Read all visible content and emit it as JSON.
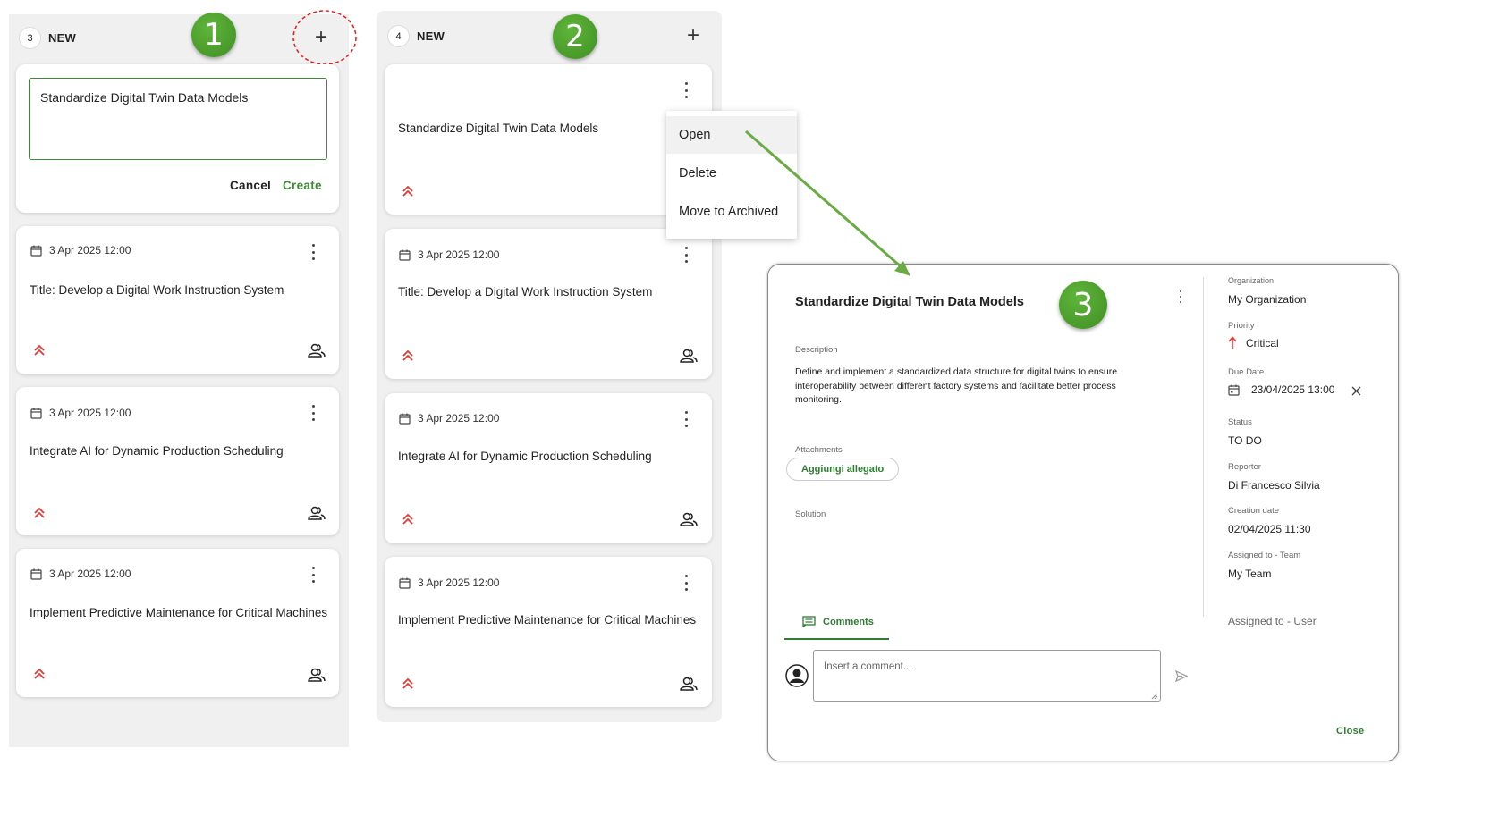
{
  "colors": {
    "accent_green": "#3d8b37",
    "priority_red": "#e53935",
    "column_bg": "#f0f0f0",
    "step_circle": "#4a9e2a"
  },
  "step_labels": [
    "1",
    "2",
    "3"
  ],
  "column1": {
    "count": "3",
    "title": "NEW",
    "new_card": {
      "input_value": "Standardize Digital Twin Data Models",
      "cancel_label": "Cancel",
      "create_label": "Create"
    },
    "cards": [
      {
        "date": "3 Apr 2025 12:00",
        "title": "Title: Develop a Digital Work Instruction System"
      },
      {
        "date": "3 Apr 2025 12:00",
        "title": "Integrate AI for Dynamic Production Scheduling"
      },
      {
        "date": "3 Apr 2025 12:00",
        "title": "Implement Predictive Maintenance for Critical Machines"
      }
    ]
  },
  "column2": {
    "count": "4",
    "title": "NEW",
    "cards": [
      {
        "date": "",
        "title": "Standardize Digital Twin Data Models"
      },
      {
        "date": "3 Apr 2025 12:00",
        "title": "Title: Develop a Digital Work Instruction System"
      },
      {
        "date": "3 Apr 2025 12:00",
        "title": "Integrate AI for Dynamic Production Scheduling"
      },
      {
        "date": "3 Apr 2025 12:00",
        "title": "Implement Predictive Maintenance for Critical Machines"
      }
    ]
  },
  "context_menu": {
    "items": [
      "Open",
      "Delete",
      "Move to Archived"
    ]
  },
  "dialog": {
    "title": "Standardize Digital Twin Data Models",
    "description_label": "Description",
    "description": "Define and implement a standardized data structure for digital twins to ensure interoperability between different factory systems and facilitate better process monitoring.",
    "attachments_label": "Attachments",
    "add_attachment": "Aggiungi allegato",
    "solution_label": "Solution",
    "comments_tab": "Comments",
    "comment_placeholder": "Insert a comment...",
    "close_label": "Close",
    "side": {
      "organization_label": "Organization",
      "organization": "My Organization",
      "priority_label": "Priority",
      "priority": "Critical",
      "due_date_label": "Due Date",
      "due_date": "23/04/2025 13:00",
      "status_label": "Status",
      "status": "TO DO",
      "reporter_label": "Reporter",
      "reporter": "Di Francesco Silvia",
      "creation_label": "Creation date",
      "creation": "02/04/2025 11:30",
      "team_label": "Assigned to - Team",
      "team": "My Team",
      "user_label": "Assigned to - User"
    }
  }
}
